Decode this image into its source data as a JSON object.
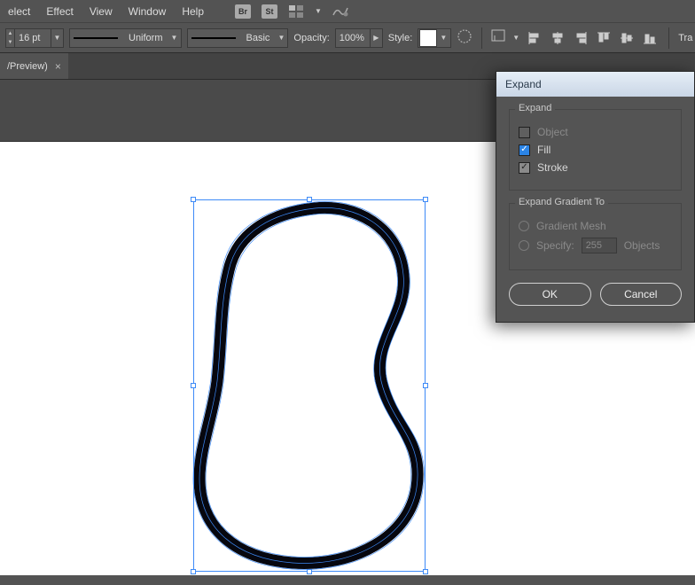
{
  "menu": [
    "elect",
    "Effect",
    "View",
    "Window",
    "Help"
  ],
  "menu_icons": {
    "br": "Br",
    "st": "St"
  },
  "optbar": {
    "stroke_weight": "16 pt",
    "profile": "Uniform",
    "brush": "Basic",
    "opacity_label": "Opacity:",
    "opacity_value": "100%",
    "style_label": "Style:",
    "tr_label": "Tra"
  },
  "tab": {
    "label": "/Preview)",
    "close": "×"
  },
  "dialog": {
    "title": "Expand",
    "group1": {
      "legend": "Expand",
      "object": "Object",
      "fill": "Fill",
      "stroke": "Stroke"
    },
    "group2": {
      "legend": "Expand Gradient To",
      "gradient_mesh": "Gradient Mesh",
      "specify": "Specify:",
      "specify_value": "255",
      "specify_unit": "Objects"
    },
    "ok": "OK",
    "cancel": "Cancel"
  }
}
